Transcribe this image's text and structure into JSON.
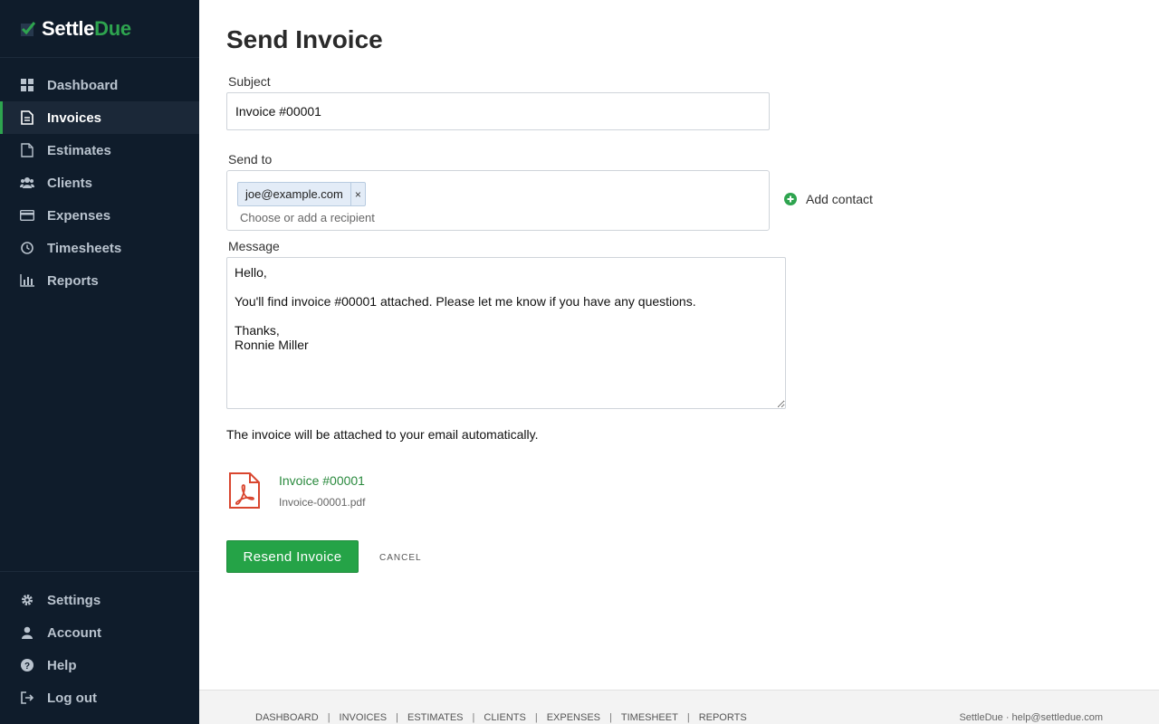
{
  "app": {
    "name_part1": "Settle",
    "name_part2": "Due",
    "accent_color": "#2ea44f"
  },
  "sidebar": {
    "nav": [
      {
        "label": "Dashboard",
        "icon": "dashboard-icon"
      },
      {
        "label": "Invoices",
        "icon": "document-icon",
        "active": true
      },
      {
        "label": "Estimates",
        "icon": "file-icon"
      },
      {
        "label": "Clients",
        "icon": "users-icon"
      },
      {
        "label": "Expenses",
        "icon": "credit-card-icon"
      },
      {
        "label": "Timesheets",
        "icon": "clock-icon"
      },
      {
        "label": "Reports",
        "icon": "bar-chart-icon"
      }
    ],
    "bottom": [
      {
        "label": "Settings",
        "icon": "gear-icon"
      },
      {
        "label": "Account",
        "icon": "user-icon"
      },
      {
        "label": "Help",
        "icon": "question-icon"
      },
      {
        "label": "Log out",
        "icon": "logout-icon"
      }
    ]
  },
  "page": {
    "title": "Send Invoice",
    "subject_label": "Subject",
    "subject_value": "Invoice #00001",
    "sendto_label": "Send to",
    "recipients": [
      "joe@example.com"
    ],
    "recipient_remove": "×",
    "recipient_placeholder": "Choose or add a recipient",
    "add_contact": "Add contact",
    "message_label": "Message",
    "message_value": "Hello,\n\nYou'll find invoice #00001 attached. Please let me know if you have any questions.\n\nThanks,\nRonnie Miller",
    "attach_note": "The invoice will be attached to your email automatically.",
    "attachment": {
      "title": "Invoice #00001",
      "filename": "Invoice-00001.pdf",
      "icon": "pdf-icon"
    },
    "resend_button": "Resend Invoice",
    "cancel_button": "CANCEL"
  },
  "footer": {
    "links": [
      "DASHBOARD",
      "INVOICES",
      "ESTIMATES",
      "CLIENTS",
      "EXPENSES",
      "TIMESHEET",
      "REPORTS"
    ],
    "separator": "|",
    "right": "SettleDue · help@settledue.com"
  }
}
